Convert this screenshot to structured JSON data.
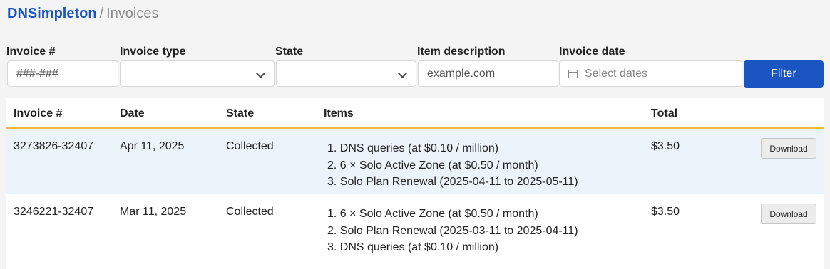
{
  "breadcrumb": {
    "brand": "DNSimpleton",
    "separator": "/",
    "current": "Invoices"
  },
  "filters": {
    "invoice_number": {
      "label": "Invoice #",
      "placeholder": "###-###"
    },
    "invoice_type": {
      "label": "Invoice type",
      "value": ""
    },
    "state": {
      "label": "State",
      "value": ""
    },
    "item_description": {
      "label": "Item description",
      "placeholder": "example.com"
    },
    "invoice_date": {
      "label": "Invoice date",
      "placeholder": "Select dates"
    },
    "filter_button": "Filter"
  },
  "table": {
    "columns": [
      "Invoice #",
      "Date",
      "State",
      "Items",
      "Total"
    ],
    "rows": [
      {
        "invoice": "3273826-32407",
        "date": "Apr 11, 2025",
        "state": "Collected",
        "items": [
          "1. DNS queries (at $0.10 / million)",
          "2. 6 × Solo Active Zone (at $0.50 / month)",
          "3. Solo Plan Renewal (2025-04-11 to 2025-05-11)"
        ],
        "total": "$3.50",
        "action": "Download"
      },
      {
        "invoice": "3246221-32407",
        "date": "Mar 11, 2025",
        "state": "Collected",
        "items": [
          "1. 6 × Solo Active Zone (at $0.50 / month)",
          "2. Solo Plan Renewal (2025-03-11 to 2025-04-11)",
          "3. DNS queries (at $0.10 / million)"
        ],
        "total": "$3.50",
        "action": "Download"
      }
    ]
  },
  "colors": {
    "brand": "#1a55c2",
    "header_rule": "#f0b83c",
    "highlight_row": "#edf3fb"
  }
}
